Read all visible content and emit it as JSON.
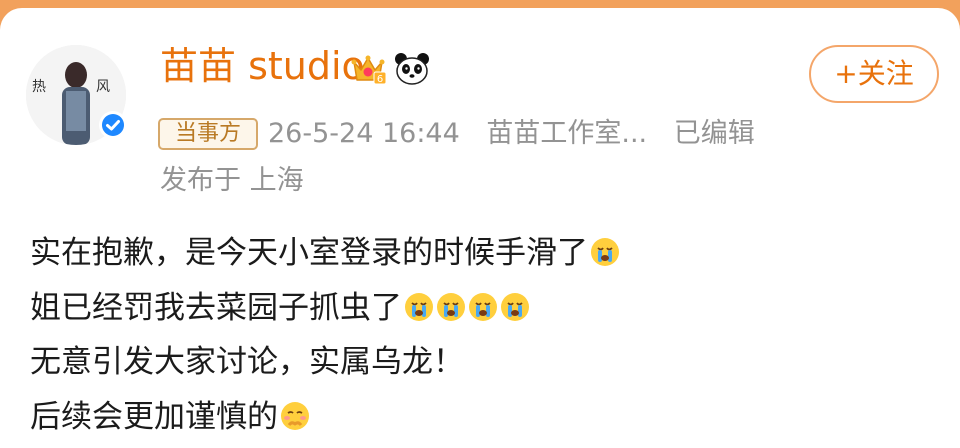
{
  "profile": {
    "name": "苗苗 studio",
    "avatar_text": "热",
    "follow_label": "+关注"
  },
  "post_meta": {
    "badge": "当事方",
    "datetime": "26-5-24 16:44",
    "source": "苗苗工作室...",
    "edited": "已编辑",
    "location": "发布于 上海"
  },
  "post": {
    "lines": [
      "实在抱歉，是今天小室登录的时候手滑了",
      "姐已经罚我去菜园子抓虫了",
      "无意引发大家讨论，实属乌龙！",
      "后续会更加谨慎的"
    ]
  },
  "icons": {
    "crown": "crown-badge-icon",
    "panda": "panda-icon",
    "verified": "verified-check-icon",
    "crying": "crying-face-emoji",
    "shy": "shy-face-emoji"
  },
  "colors": {
    "accent": "#e8720c",
    "meta_gray": "#939393",
    "badge_border": "#d6a86a",
    "verified_blue": "#1e88ff",
    "top_band": "#f2a15c"
  }
}
